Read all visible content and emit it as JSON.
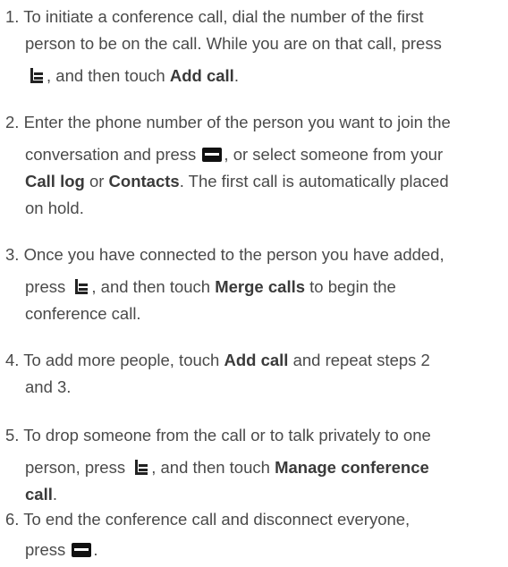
{
  "steps": [
    {
      "num": "1.",
      "l1": "To initiate a conference call, dial the number of the first",
      "l2": "person to be on the call. While you are on that call, press",
      "l3a": ", and then touch ",
      "l3b": "Add call",
      "l3c": "."
    },
    {
      "num": "2.",
      "l1": "Enter the phone number of the person you want to join the",
      "l2a": "conversation and press ",
      "l2b": ", or select someone from your",
      "l3a": "Call log",
      "l3b": " or ",
      "l3c": "Contacts",
      "l3d": ". The first call is automatically placed",
      "l4": "on hold."
    },
    {
      "num": "3.",
      "l1": "Once you have connected to the person you have added,",
      "l2a": "press ",
      "l2b": ", and then touch ",
      "l2c": "Merge calls",
      "l2d": " to begin the",
      "l3": "conference call."
    },
    {
      "num": "4.",
      "l1a": "To add more people, touch ",
      "l1b": "Add call",
      "l1c": " and repeat steps 2",
      "l2": "and 3."
    },
    {
      "num": "5.",
      "l1": "To drop someone from the call or to talk privately to one",
      "l2a": "person, press ",
      "l2b": ", and then touch ",
      "l2c": "Manage conference",
      "l3a": "call",
      "l3b": "."
    },
    {
      "num": "6.",
      "l1": "To end the conference call and disconnect everyone,",
      "l2a": "press ",
      "l2b": "."
    }
  ],
  "icons": {
    "menu": "menu-key-icon",
    "end_call": "end-call-key-icon"
  }
}
